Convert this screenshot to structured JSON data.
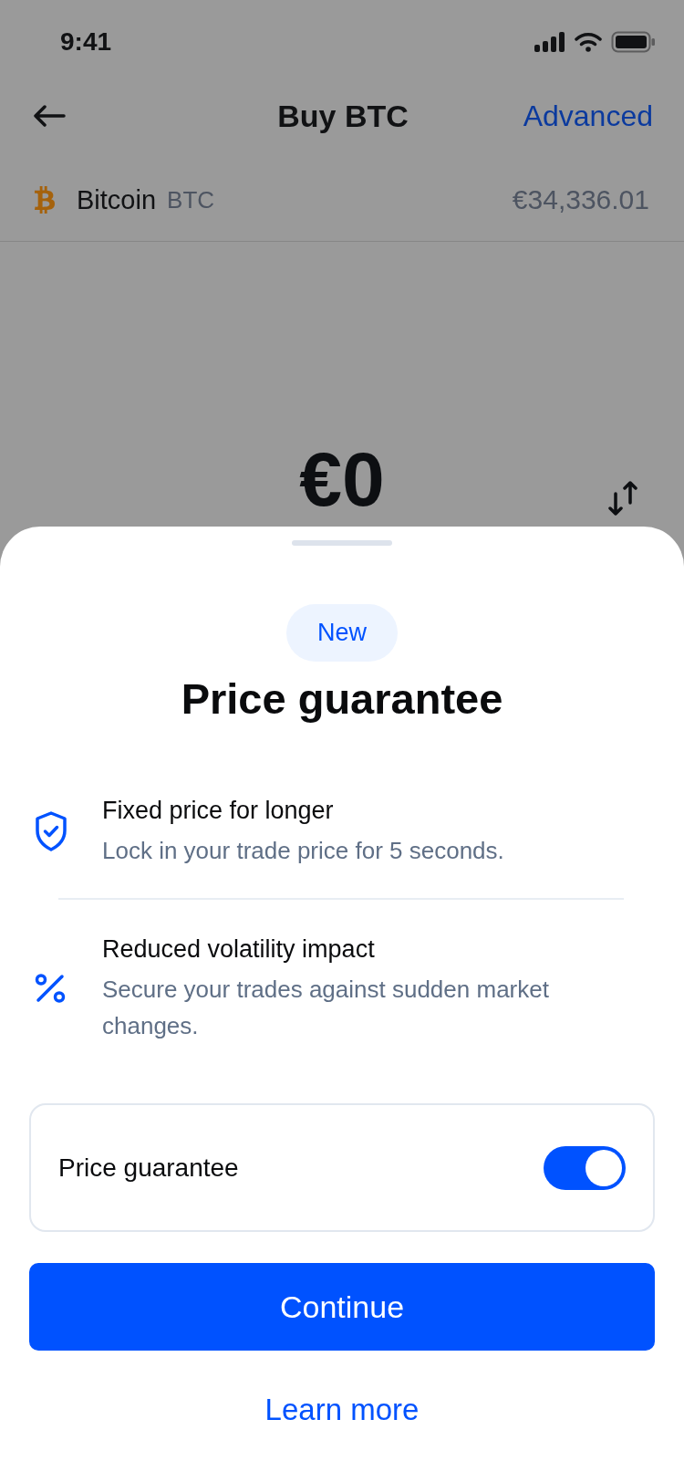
{
  "status_bar": {
    "time": "9:41"
  },
  "header": {
    "title": "Buy BTC",
    "action": "Advanced"
  },
  "asset": {
    "name": "Bitcoin",
    "symbol": "BTC",
    "price": "€34,336.01"
  },
  "amount": {
    "value": "€0"
  },
  "sheet": {
    "badge": "New",
    "title": "Price guarantee",
    "features": [
      {
        "kind": "shield",
        "title": "Fixed price for longer",
        "description": "Lock in your trade price for 5 seconds."
      },
      {
        "kind": "percent",
        "title": "Reduced volatility impact",
        "description": "Secure your trades against sudden market changes."
      }
    ],
    "setting": {
      "label": "Price guarantee",
      "on": true
    },
    "primary_button": "Continue",
    "link": "Learn more"
  }
}
